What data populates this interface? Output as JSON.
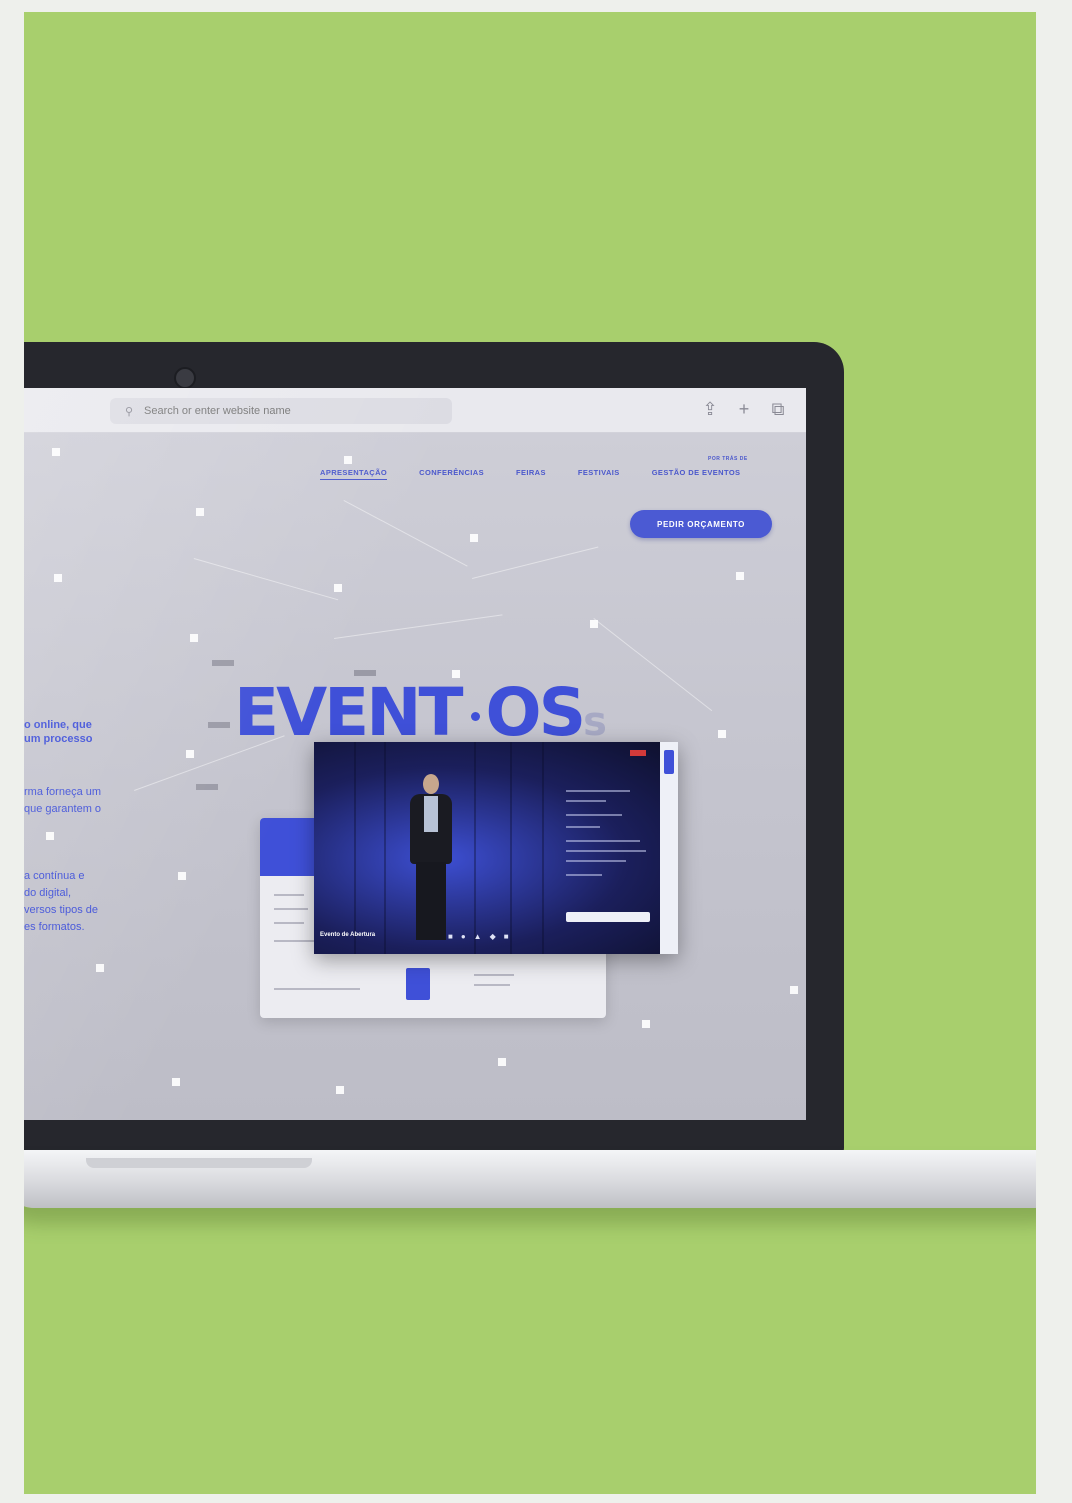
{
  "browser": {
    "search_placeholder": "Search or enter website name",
    "search_icon": "search-icon",
    "actions": [
      {
        "name": "share-icon",
        "glyph": "⇪"
      },
      {
        "name": "new-tab-icon",
        "glyph": "+"
      },
      {
        "name": "tabs-icon",
        "glyph": "⧉"
      }
    ]
  },
  "site": {
    "nav": {
      "items": [
        {
          "label": "Apresentação",
          "active": true
        },
        {
          "label": "Conferências"
        },
        {
          "label": "Feiras"
        },
        {
          "label": "Festivais"
        },
        {
          "label": "Gestão de Eventos"
        }
      ],
      "superscript": "POR TRÁS DE"
    },
    "cta_label": "PEDIR ORÇAMENTO",
    "logo": {
      "main": "EVENT",
      "suffix": "OS",
      "tail": "s"
    },
    "tagline": "o online, que\num processo",
    "desc_1": "rma forneça um\nque garantem o",
    "desc_2": "a contínua e\n do digital,\nversos tipos de\nes formatos.",
    "preview": {
      "caption": "Evento de Abertura"
    }
  },
  "colors": {
    "background": "#a8cf6d",
    "accent": "#3f50d8",
    "screen": "#c6c6d0"
  }
}
